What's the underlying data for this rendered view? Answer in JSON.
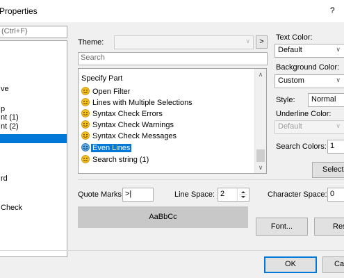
{
  "dialog": {
    "title": "Properties",
    "help": "?"
  },
  "left_panel": {
    "search_placeholder": "(Ctrl+F)",
    "items": [
      "ve",
      "p",
      "nt (1)",
      "nt (2)",
      "",
      "rd",
      "Check"
    ]
  },
  "theme": {
    "label": "Theme:",
    "value": "",
    "next_button": ">"
  },
  "search": {
    "placeholder": "Search"
  },
  "specify_part": {
    "header": "Specify Part",
    "items": [
      {
        "label": "Open Filter",
        "icon": "smiley-yellow-icon"
      },
      {
        "label": "Lines with Multiple Selections",
        "icon": "smiley-yellow-icon"
      },
      {
        "label": "Syntax Check Errors",
        "icon": "smiley-yellow-icon"
      },
      {
        "label": "Syntax Check Warnings",
        "icon": "smiley-yellow-icon"
      },
      {
        "label": "Syntax Check Messages",
        "icon": "smiley-yellow-icon"
      },
      {
        "label": "Even Lines",
        "icon": "smiley-blue-icon",
        "selected": true
      },
      {
        "label": "Search string (1)",
        "icon": "smiley-yellow-icon"
      }
    ]
  },
  "text_color": {
    "label": "Text Color:",
    "value": "Default"
  },
  "background_color": {
    "label": "Background Color:",
    "value": "Custom"
  },
  "style": {
    "label": "Style:",
    "value": "Normal"
  },
  "underline_color": {
    "label": "Underline Color:",
    "value": "Default"
  },
  "search_colors": {
    "label": "Search Colors:",
    "value": "1"
  },
  "select_button": "Select",
  "quote_marks": {
    "label": "Quote Marks:",
    "value": ">|"
  },
  "line_space": {
    "label": "Line Space:",
    "value": "2"
  },
  "character_space": {
    "label": "Character Space:",
    "value": "0"
  },
  "preview_text": "AaBbCc",
  "font_button": "Font...",
  "reset_button": "Reset",
  "ok_button": "OK",
  "cancel_button": "Car",
  "colors": {
    "selection": "#0078d7",
    "preview_bg": "#c8c8c8"
  }
}
